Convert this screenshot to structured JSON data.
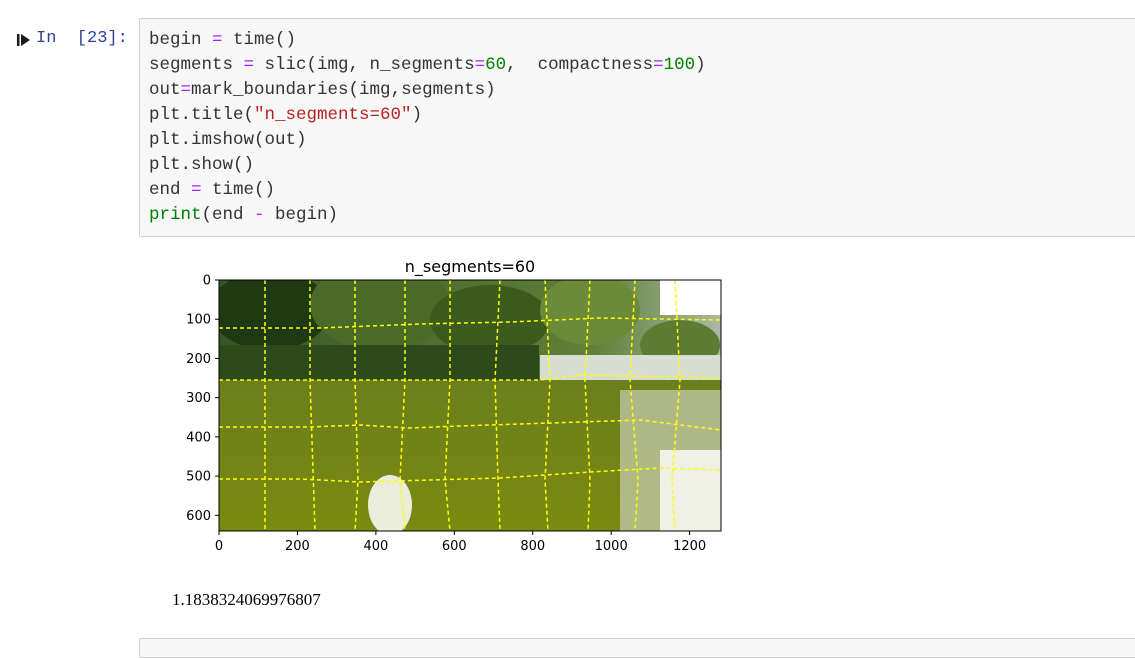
{
  "cell": {
    "prompt": "In  [23]:",
    "code_lines": [
      [
        {
          "t": "begin "
        },
        {
          "t": "=",
          "c": "op"
        },
        {
          "t": " time()"
        }
      ],
      [
        {
          "t": "segments "
        },
        {
          "t": "=",
          "c": "op"
        },
        {
          "t": " slic(img, n_segments"
        },
        {
          "t": "=",
          "c": "op"
        },
        {
          "t": "60",
          "c": "num"
        },
        {
          "t": ",  compactness"
        },
        {
          "t": "=",
          "c": "op"
        },
        {
          "t": "100",
          "c": "num"
        },
        {
          "t": ")"
        }
      ],
      [
        {
          "t": "out"
        },
        {
          "t": "=",
          "c": "op"
        },
        {
          "t": "mark_boundaries(img,segments)"
        }
      ],
      [
        {
          "t": "plt.title("
        },
        {
          "t": "\"n_segments=60\"",
          "c": "str"
        },
        {
          "t": ")"
        }
      ],
      [
        {
          "t": "plt.imshow(out)"
        }
      ],
      [
        {
          "t": "plt.show()"
        }
      ],
      [
        {
          "t": "end "
        },
        {
          "t": "=",
          "c": "op"
        },
        {
          "t": " time()"
        }
      ],
      [
        {
          "t": "print",
          "c": "kw"
        },
        {
          "t": "(end "
        },
        {
          "t": "-",
          "c": "op"
        },
        {
          "t": " begin)"
        }
      ]
    ]
  },
  "plot": {
    "title": "n_segments=60",
    "y_ticks": [
      "0",
      "100",
      "200",
      "300",
      "400",
      "500",
      "600"
    ],
    "x_ticks": [
      "0",
      "200",
      "400",
      "600",
      "800",
      "1000",
      "1200"
    ],
    "image_description_icon": "segmented-photo"
  },
  "output": {
    "text": "1.1838324069976807"
  },
  "colors": {
    "prompt": "#303f9f",
    "boundary": "#ffff00"
  }
}
